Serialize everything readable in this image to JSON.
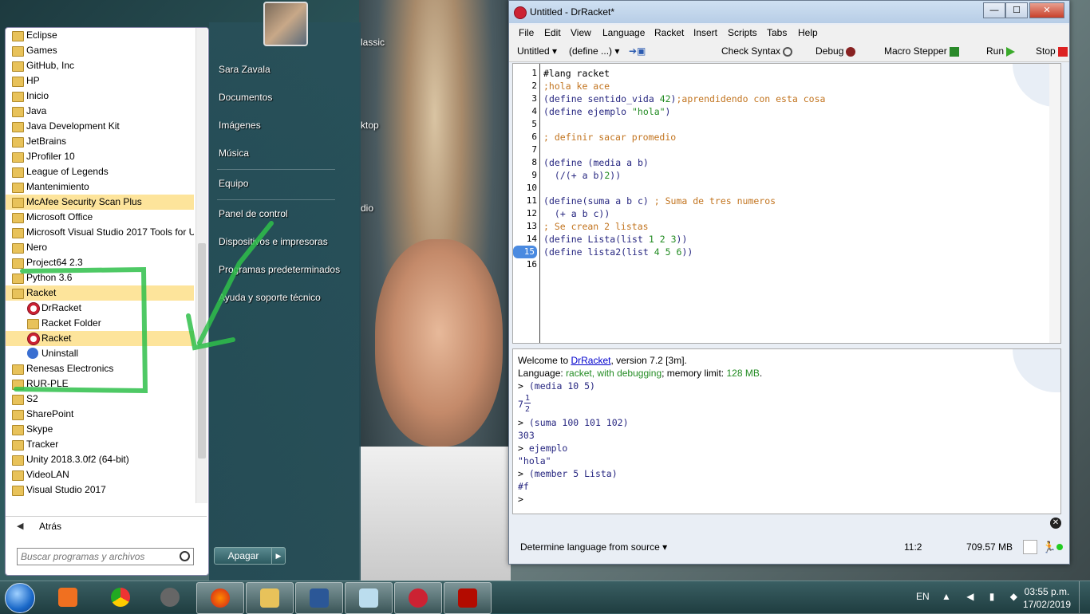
{
  "desktop": {
    "labels": [
      "lassic",
      "ktop",
      "dio"
    ]
  },
  "start_menu": {
    "programs": [
      {
        "label": "Eclipse",
        "kind": "folder"
      },
      {
        "label": "Games",
        "kind": "folder"
      },
      {
        "label": "GitHub, Inc",
        "kind": "folder"
      },
      {
        "label": "HP",
        "kind": "folder"
      },
      {
        "label": "Inicio",
        "kind": "folder"
      },
      {
        "label": "Java",
        "kind": "folder"
      },
      {
        "label": "Java Development Kit",
        "kind": "folder"
      },
      {
        "label": "JetBrains",
        "kind": "folder"
      },
      {
        "label": "JProfiler 10",
        "kind": "folder"
      },
      {
        "label": "League of Legends",
        "kind": "folder"
      },
      {
        "label": "Mantenimiento",
        "kind": "folder"
      },
      {
        "label": "McAfee Security Scan Plus",
        "kind": "folder",
        "highlight": true
      },
      {
        "label": "Microsoft Office",
        "kind": "folder"
      },
      {
        "label": "Microsoft Visual Studio 2017 Tools for U",
        "kind": "folder"
      },
      {
        "label": "Nero",
        "kind": "folder"
      },
      {
        "label": "Project64 2.3",
        "kind": "folder"
      },
      {
        "label": "Python 3.6",
        "kind": "folder"
      },
      {
        "label": "Racket",
        "kind": "folder",
        "highlight": true
      },
      {
        "label": "DrRacket",
        "kind": "racket",
        "sub": true
      },
      {
        "label": "Racket Folder",
        "kind": "folder",
        "sub": true
      },
      {
        "label": "Racket",
        "kind": "racket",
        "sub": true,
        "highlight": true
      },
      {
        "label": "Uninstall",
        "kind": "uninstall",
        "sub": true
      },
      {
        "label": "Renesas Electronics",
        "kind": "folder"
      },
      {
        "label": "RUR-PLE",
        "kind": "folder"
      },
      {
        "label": "S2",
        "kind": "folder"
      },
      {
        "label": "SharePoint",
        "kind": "folder"
      },
      {
        "label": "Skype",
        "kind": "folder"
      },
      {
        "label": "Tracker",
        "kind": "folder"
      },
      {
        "label": "Unity 2018.3.0f2 (64-bit)",
        "kind": "folder"
      },
      {
        "label": "VideoLAN",
        "kind": "folder"
      },
      {
        "label": "Visual Studio 2017",
        "kind": "folder"
      }
    ],
    "back_label": "Atrás",
    "search_placeholder": "Buscar programas y archivos",
    "right_items": {
      "user": "Sara Zavala",
      "documents": "Documentos",
      "images": "Imágenes",
      "music": "Música",
      "computer": "Equipo",
      "control_panel": "Panel de control",
      "devices": "Dispositivos e impresoras",
      "default_programs": "Programas predeterminados",
      "help": "Ayuda y soporte técnico"
    },
    "shutdown_label": "Apagar"
  },
  "drracket": {
    "title": "Untitled - DrRacket*",
    "menu": [
      "File",
      "Edit",
      "View",
      "Language",
      "Racket",
      "Insert",
      "Scripts",
      "Tabs",
      "Help"
    ],
    "toolbar": {
      "tab_name": "Untitled",
      "define_menu": "(define ...)",
      "check_syntax": "Check Syntax",
      "debug": "Debug",
      "macro_stepper": "Macro Stepper",
      "run": "Run",
      "stop": "Stop"
    },
    "line_numbers": [
      "1",
      "2",
      "3",
      "4",
      "5",
      "6",
      "7",
      "8",
      "9",
      "10",
      "11",
      "12",
      "13",
      "14",
      "15",
      "16"
    ],
    "current_line": 15,
    "code": [
      "#lang racket",
      ";hola ke ace",
      "(define sentido_vida 42);aprendidendo con esta cosa",
      "(define ejemplo \"hola\")",
      "",
      "; definir sacar promedio",
      "",
      "(define (media a b)",
      "  (/(+ a b)2))",
      "",
      "(define(suma a b c) ; Suma de tres numeros",
      "  (+ a b c))",
      "; Se crean 2 listas",
      "(define Lista(list 1 2 3))",
      "(define lista2(list 4 5 6))",
      ""
    ],
    "repl": {
      "welcome_prefix": "Welcome to ",
      "welcome_link": "DrRacket",
      "welcome_suffix": ", version 7.2 [3m].",
      "lang_prefix": "Language: ",
      "lang_value": "racket, with debugging",
      "mem_prefix": "; memory limit: ",
      "mem_value": "128 MB",
      "mem_suffix": ".",
      "prompt": ">",
      "in1": "(media 10 5)",
      "out1_whole": "7",
      "out1_num": "1",
      "out1_den": "2",
      "in2": "(suma 100 101 102)",
      "out2": "303",
      "in3": "ejemplo",
      "out3": "\"hola\"",
      "in4": "(member 5 Lista)",
      "out4": "#f"
    },
    "status": {
      "language": "Determine language from source",
      "position": "11:2",
      "memory": "709.57 MB"
    }
  },
  "taskbar": {
    "apps": [
      "media-player",
      "chrome",
      "webcam",
      "firefox",
      "file-explorer",
      "word",
      "notepad",
      "drracket",
      "acrobat"
    ],
    "language": "EN",
    "time": "03:55 p.m.",
    "date": "17/02/2019"
  }
}
